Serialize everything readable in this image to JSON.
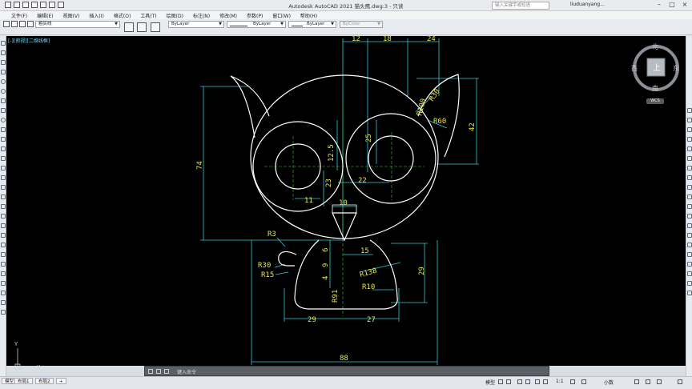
{
  "window": {
    "title": "Autodesk AutoCAD 2021    猫头鹰.dwg:3 - 只读",
    "search_placeholder": "键入关键字或短语",
    "user": "liuduanyang..."
  },
  "menu": [
    "文件(F)",
    "编辑(E)",
    "视图(V)",
    "插入(I)",
    "格式(O)",
    "工具(T)",
    "绘图(D)",
    "标注(N)",
    "修改(M)",
    "参数(P)",
    "窗口(W)",
    "帮助(H)"
  ],
  "toolbar": {
    "layer_value": "粗实线",
    "color_value": "ByLayer",
    "linetype_value": "ByLayer",
    "lineweight_value": "ByLayer",
    "plotstyle_value": "ByColor"
  },
  "viewport": {
    "label": "[-][俯视][二维线框]"
  },
  "viewcube": {
    "north": "北",
    "south": "南",
    "east": "东",
    "west": "西",
    "top": "上",
    "wcs": "WCS"
  },
  "drawing": {
    "dims": {
      "d12": "12",
      "d18": "18",
      "d24": "24",
      "r30_ear": "R30",
      "r100": "R100",
      "r60": "R60",
      "d42": "42",
      "d74": "74",
      "d12_5": "12.5",
      "d25": "25",
      "d23": "23",
      "d22": "22",
      "d11": "11",
      "d10": "10",
      "r3": "R3",
      "d6": "6",
      "d15": "15",
      "d9": "9",
      "r30_tail": "R30",
      "r15": "R15",
      "d4": "4",
      "r138": "R138",
      "d29_v": "29",
      "r10": "R10",
      "r91": "R91",
      "d29_h": "29",
      "d27": "27",
      "d88": "88"
    }
  },
  "ucs": {
    "y": "Y",
    "x": "X"
  },
  "command": {
    "placeholder": "键入命令"
  },
  "status": {
    "tabs": [
      "模型",
      "布局1",
      "布局2"
    ],
    "model_label": "模型",
    "scale": "1:1",
    "units": "小数"
  }
}
